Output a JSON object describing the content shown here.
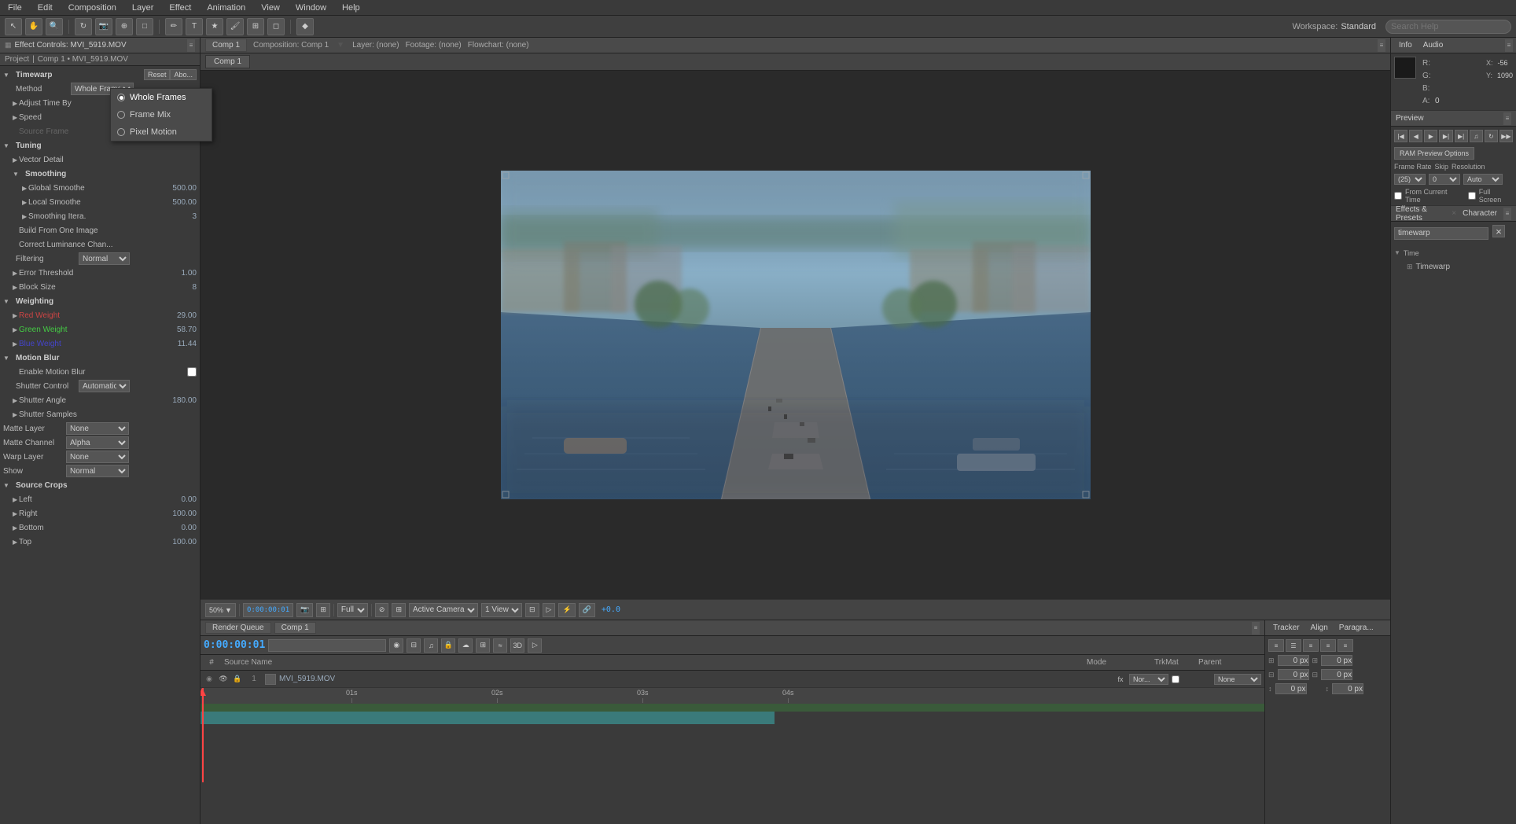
{
  "app": {
    "title": "Adobe After Effects"
  },
  "menu": {
    "items": [
      "File",
      "Edit",
      "Composition",
      "Layer",
      "Effect",
      "Animation",
      "View",
      "Window",
      "Help"
    ]
  },
  "toolbar": {
    "workspace_label": "Workspace:",
    "workspace_value": "Standard",
    "search_placeholder": "Search Help"
  },
  "effect_controls": {
    "title": "Effect Controls: MVI_5919.MOV",
    "breadcrumb": "Comp 1 • MVI_5919.MOV",
    "reset_label": "Reset",
    "about_label": "Abo...",
    "effect_name": "Timewarp",
    "method_label": "Method",
    "method_value": "Whole Frames",
    "adjust_time_by": "Adjust Time By",
    "speed_label": "Speed",
    "source_frame": "Source Frame",
    "tuning_label": "Tuning",
    "vector_detail": "Vector Detail",
    "smoothing_label": "Smoothing",
    "global_smoothe": "Global Smoothe",
    "global_value": "500.00",
    "local_smoothe": "Local Smoothe",
    "local_value": "500.00",
    "smoothing_iters": "Smoothing Itera.",
    "smoothing_iters_val": "3",
    "build_from_one": "Build From One Image",
    "correct_luminance": "Correct Luminance Chan...",
    "filtering_label": "Filtering",
    "filtering_value": "Normal",
    "error_threshold": "Error Threshold",
    "error_value": "1.00",
    "block_size": "Block Size",
    "block_value": "8",
    "weighting_label": "Weighting",
    "red_weight": "Red Weight",
    "red_value": "29.00",
    "green_weight": "Green Weight",
    "green_value": "58.70",
    "blue_weight": "Blue Weight",
    "blue_value": "11.44",
    "motion_blur": "Motion Blur",
    "enable_motion_blur": "Enable Motion Blur",
    "shutter_control": "Shutter Control",
    "shutter_value": "Automatic",
    "shutter_angle": "Shutter Angle",
    "shutter_angle_val": "180.00",
    "shutter_samples": "Shutter Samples",
    "matte_layer": "Matte Layer",
    "matte_layer_val": "None",
    "matte_channel": "Matte Channel",
    "matte_channel_val": "Alpha",
    "warp_layer": "Warp Layer",
    "warp_layer_val": "None",
    "show_label": "Show",
    "show_value": "Normal",
    "source_crops": "Source Crops",
    "left_label": "Left",
    "left_value": "0.00",
    "right_label": "Right",
    "right_value": "100.00",
    "bottom_label": "Bottom",
    "bottom_value": "0.00",
    "top_label": "Top",
    "top_value": "100.00"
  },
  "dropdown_popup": {
    "title": "Method",
    "items": [
      {
        "label": "Whole Frames",
        "selected": true
      },
      {
        "label": "Frame Mix",
        "selected": false
      },
      {
        "label": "Pixel Motion",
        "selected": false
      }
    ]
  },
  "composition": {
    "tab_label": "Comp 1",
    "header_composition": "Composition: Comp 1",
    "header_layer": "Layer: (none)",
    "header_footage": "Footage: (none)",
    "header_flowchart": "Flowchart: (none)",
    "timecode": "0:00:00:01",
    "zoom": "50%",
    "view_label": "Full",
    "camera_label": "Active Camera",
    "view_count": "1 View"
  },
  "info": {
    "tab": "Info",
    "audio_tab": "Audio",
    "r_label": "R:",
    "g_label": "G:",
    "b_label": "B:",
    "a_label": "A:",
    "a_value": "0",
    "x_label": "X:",
    "x_value": "-56",
    "y_label": "Y:",
    "y_value": "1090"
  },
  "preview": {
    "tab": "Preview",
    "ram_preview_label": "RAM Preview Options",
    "frame_rate_label": "Frame Rate",
    "skip_label": "Skip",
    "resolution_label": "Resolution",
    "frame_rate_value": "(25)",
    "skip_value": "0",
    "resolution_value": "Auto",
    "from_current_time_label": "From Current Time",
    "full_screen_label": "Full Screen"
  },
  "effects_presets": {
    "tab": "Effects & Presets",
    "character_tab": "Character",
    "search_placeholder": "timewarp",
    "time_category": "Time",
    "timewarp_item": "Timewarp"
  },
  "timeline": {
    "render_queue_tab": "Render Queue",
    "comp_tab": "Comp 1",
    "timecode": "0:00:00:01",
    "columns": {
      "source_name": "Source Name",
      "mode": "Mode",
      "trimat": "TrkMat",
      "parent": "Parent"
    },
    "layer": {
      "num": "1",
      "name": "MVI_5919.MOV",
      "mode": "Nor...",
      "parent": "None"
    },
    "ruler": {
      "marks": [
        "01s",
        "02s",
        "03s",
        "04s"
      ]
    }
  },
  "bottom_right": {
    "tracker_tab": "Tracker",
    "align_tab": "Align",
    "paragraph_tab": "Paragra...",
    "indent_values": [
      "0 px",
      "0 px",
      "0 px",
      "0 px",
      "0 px"
    ],
    "spacing_values": [
      "0 px",
      "0 px"
    ]
  }
}
